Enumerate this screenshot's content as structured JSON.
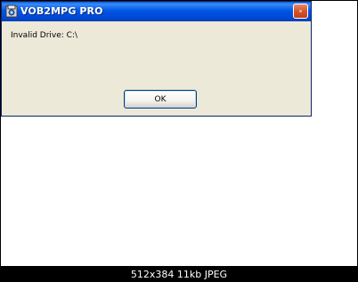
{
  "viewer": {
    "image_info": "512x384 11kb JPEG"
  },
  "dialog": {
    "title": "VOB2MPG PRO",
    "message": "Invalid Drive: C:\\",
    "ok_label": "OK",
    "app_icon": "app-icon",
    "close_icon": "close-icon"
  },
  "colors": {
    "titlebar": "#0055e5",
    "dialog_background": "#ece9d8",
    "close_button": "#d4542c",
    "frame": "#000000"
  }
}
